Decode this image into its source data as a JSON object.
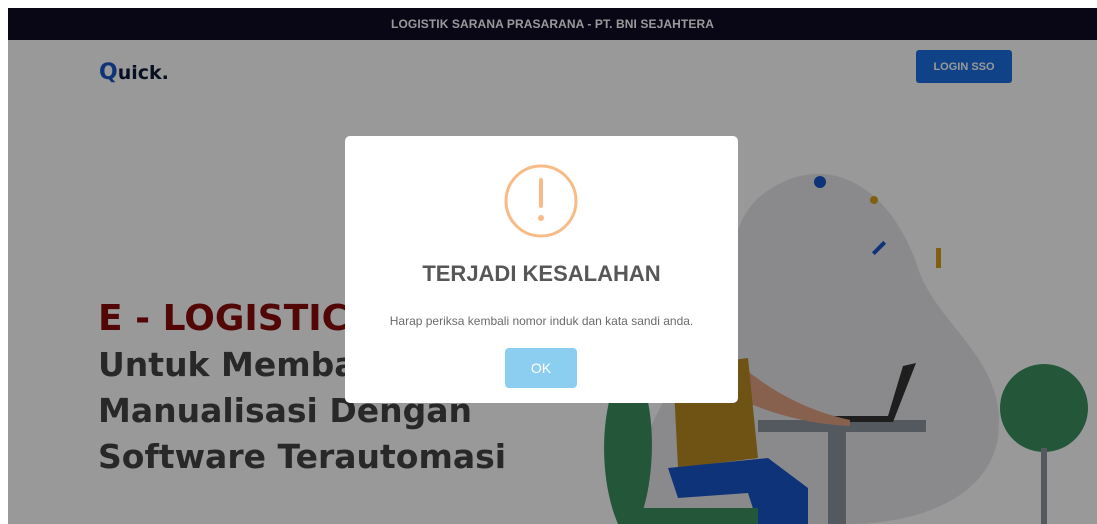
{
  "topbar": {
    "text": "LOGISTIK SARANA PRASARANA - PT. BNI SEJAHTERA"
  },
  "nav": {
    "logo_first": "Q",
    "logo_rest": "uick.",
    "login_label": "LOGIN SSO"
  },
  "hero": {
    "title": "E - LOGISTICS",
    "line1": "Untuk Membantu",
    "line2": "Manualisasi Dengan",
    "line3": "Software Terautomasi"
  },
  "modal": {
    "title": "TERJADI KESALAHAN",
    "message": "Harap periksa kembali nomor induk dan kata sandi anda.",
    "ok_label": "OK"
  },
  "colors": {
    "topbar": "#0f0a24",
    "login_button": "#1a6fe0",
    "hero_title": "#8b0a0a",
    "warning_icon": "#f8bb86",
    "ok_button": "#8ccef0"
  }
}
